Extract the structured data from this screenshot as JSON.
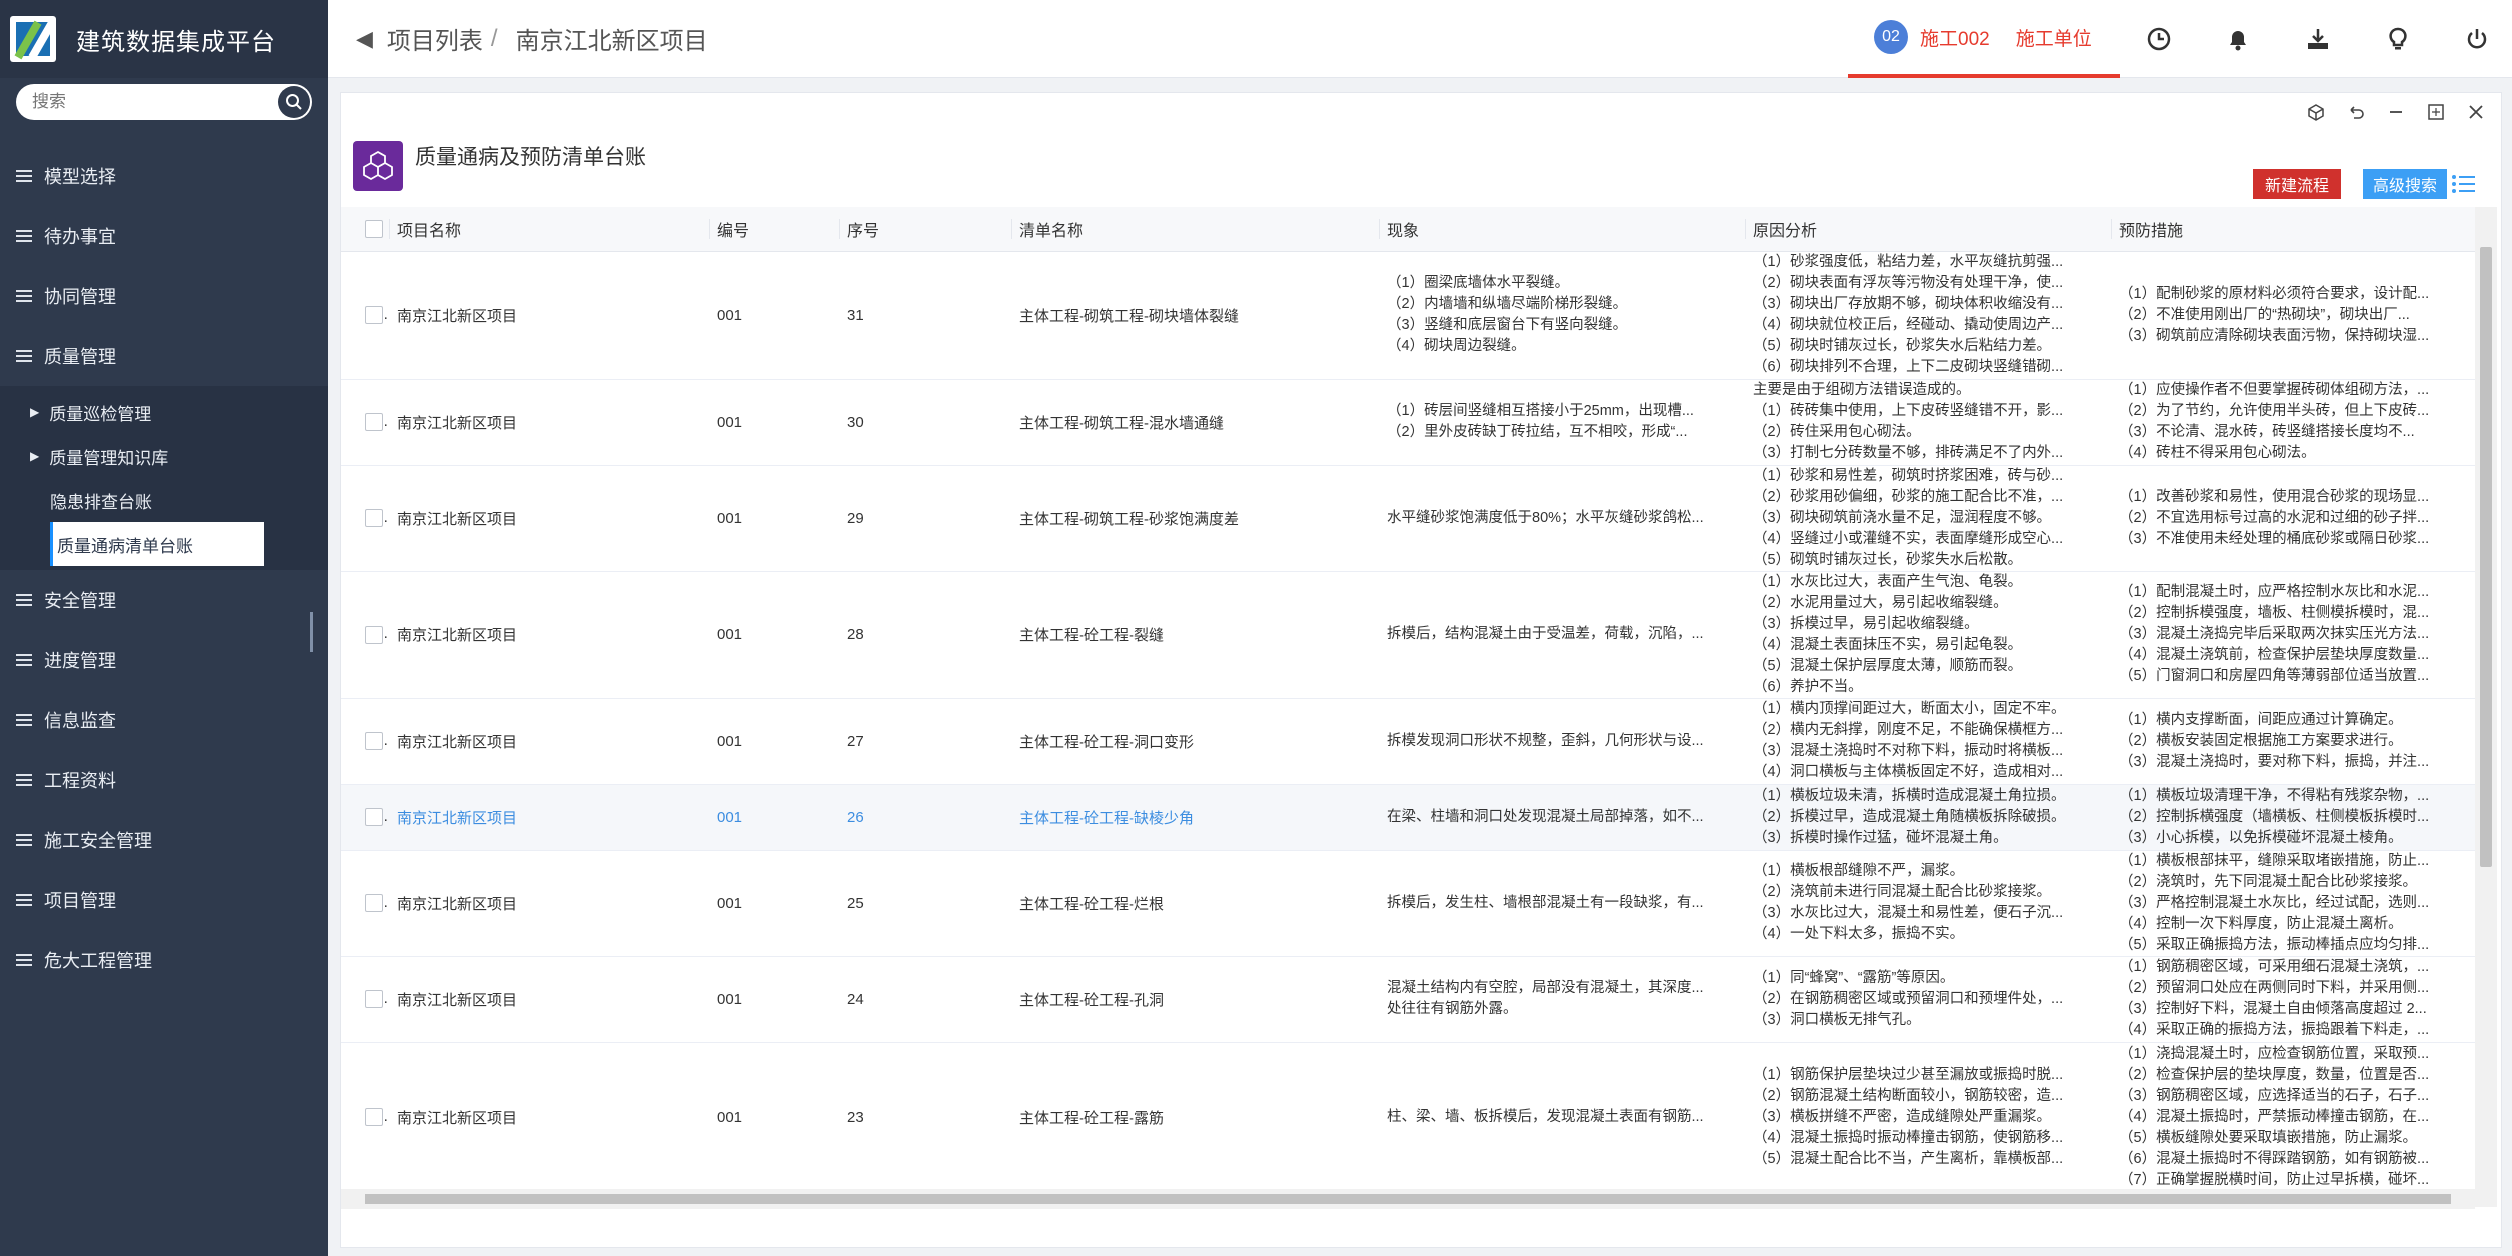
{
  "app": {
    "title": "建筑数据集成平台"
  },
  "search": {
    "placeholder": "搜索"
  },
  "sidebar": {
    "items": [
      {
        "label": "模型选择"
      },
      {
        "label": "待办事宜"
      },
      {
        "label": "协同管理"
      },
      {
        "label": "质量管理"
      },
      {
        "label": "安全管理"
      },
      {
        "label": "进度管理"
      },
      {
        "label": "信息监查"
      },
      {
        "label": "工程资料"
      },
      {
        "label": "施工安全管理"
      },
      {
        "label": "项目管理"
      },
      {
        "label": "危大工程管理"
      }
    ],
    "quality_sub": [
      {
        "label": "质量巡检管理"
      },
      {
        "label": "质量管理知识库"
      },
      {
        "label": "隐患排查台账"
      },
      {
        "label": "质量通病清单台账"
      }
    ]
  },
  "breadcrumb": {
    "parent": "项目列表",
    "separator": "/",
    "current": "南京江北新区项目"
  },
  "user": {
    "badge": "02",
    "name": "施工002",
    "role": "施工单位"
  },
  "panel": {
    "title": "质量通病及预防清单台账",
    "new_flow": "新建流程",
    "advanced_search": "高级搜索"
  },
  "table": {
    "headers": [
      "项目名称",
      "编号",
      "序号",
      "清单名称",
      "现象",
      "原因分析",
      "预防措施"
    ],
    "rows": [
      {
        "project": "南京江北新区项目",
        "code": "001",
        "seq": "31",
        "name": "主体工程-砌筑工程-砌块墙体裂缝",
        "phenomenon": [
          "（1）圈梁底墙体水平裂缝。",
          "（2）内墙墙和纵墙尽端阶梯形裂缝。",
          "（3）竖缝和底层窗台下有竖向裂缝。",
          "（4）砌块周边裂缝。"
        ],
        "cause": [
          "（1）砂浆强度低，粘结力差，水平灰缝抗剪强...",
          "（2）砌块表面有浮灰等污物没有处理干净，使...",
          "（3）砌块出厂存放期不够，砌块体积收缩没有...",
          "（4）砌块就位校正后，经碰动、撬动使周边产...",
          "（5）砌块时铺灰过长，砂浆失水后粘结力差。",
          "（6）砌块排列不合理，上下二皮砌块竖缝错砌..."
        ],
        "prevention": [
          "（1）配制砂浆的原材料必须符合要求，设计配...",
          "（2）不准使用刚出厂的“热砌块”，砌块出厂...",
          "（3）砌筑前应清除砌块表面污物，保持砌块湿..."
        ]
      },
      {
        "project": "南京江北新区项目",
        "code": "001",
        "seq": "30",
        "name": "主体工程-砌筑工程-混水墙通缝",
        "phenomenon": [
          "（1）砖层间竖缝相互搭接小于25mm，出现槽...",
          "（2）里外皮砖缺丁砖拉结，互不相咬，形成“..."
        ],
        "cause": [
          "主要是由于组砌方法错误造成的。",
          "（1）砖砖集中使用，上下皮砖竖缝错不开，影...",
          "（2）砖住采用包心砌法。",
          "（3）打制七分砖数量不够，排砖满足不了内外..."
        ],
        "prevention": [
          "（1）应使操作者不但要掌握砖砌体组砌方法，...",
          "（2）为了节约，允许使用半头砖，但上下皮砖...",
          "（3）不论清、混水砖，砖竖缝搭接长度均不...",
          "（4）砖柱不得采用包心砌法。"
        ]
      },
      {
        "project": "南京江北新区项目",
        "code": "001",
        "seq": "29",
        "name": "主体工程-砌筑工程-砂浆饱满度差",
        "phenomenon": [
          "水平缝砂浆饱满度低于80%；水平灰缝砂浆鸽松..."
        ],
        "cause": [
          "（1）砂浆和易性差，砌筑时挤浆困难，砖与砂...",
          "（2）砂浆用砂偏细，砂浆的施工配合比不准，...",
          "（3）砌块砌筑前浇水量不足，湿润程度不够。",
          "（4）竖缝过小或灌缝不实，表面摩缝形成空心...",
          "（5）砌筑时铺灰过长，砂浆失水后松散。"
        ],
        "prevention": [
          "（1）改善砂浆和易性，使用混合砂浆的现场显...",
          "（2）不宜选用标号过高的水泥和过细的砂子拌...",
          "（3）不准使用未经处理的桶底砂浆或隔日砂浆..."
        ]
      },
      {
        "project": "南京江北新区项目",
        "code": "001",
        "seq": "28",
        "name": "主体工程-砼工程-裂缝",
        "phenomenon": [
          "拆模后，结构混凝土由于受温差，荷载，沉陷，..."
        ],
        "cause": [
          "（1）水灰比过大，表面产生气泡、龟裂。",
          "（2）水泥用量过大，易引起收缩裂缝。",
          "（3）拆模过早，易引起收缩裂缝。",
          "（4）混凝土表面抹压不实，易引起龟裂。",
          "（5）混凝土保护层厚度太薄，顺筋而裂。",
          "（6）养护不当。"
        ],
        "prevention": [
          "（1）配制混凝土时，应严格控制水灰比和水泥...",
          "（2）控制拆模强度，墙板、柱侧模拆模时，混...",
          "（3）混凝土浇捣完毕后采取两次抹实压光方法...",
          "（4）混凝土浇筑前，检查保护层垫块厚度数量...",
          "（5）门窗洞口和房屋四角等薄弱部位适当放置..."
        ]
      },
      {
        "project": "南京江北新区项目",
        "code": "001",
        "seq": "27",
        "name": "主体工程-砼工程-洞口变形",
        "phenomenon": [
          "拆模发现洞口形状不规整，歪斜，几何形状与设..."
        ],
        "cause": [
          "（1）横内顶撑间距过大，断面太小，固定不牢。",
          "（2）横内无斜撑，刚度不足，不能确保横框方...",
          "（3）混凝土浇捣时不对称下料，振动时将横板...",
          "（4）洞口横板与主体横板固定不好，造成相对..."
        ],
        "prevention": [
          "（1）横内支撑断面，间距应通过计算确定。",
          "（2）横板安装固定根据施工方案要求进行。",
          "（3）混凝土浇捣时，要对称下料，振捣，并注..."
        ]
      },
      {
        "project": "南京江北新区项目",
        "code": "001",
        "seq": "26",
        "name": "主体工程-砼工程-缺棱少角",
        "phenomenon": [
          "在梁、柱墙和洞口处发现混凝土局部掉落，如不..."
        ],
        "cause": [
          "（1）横板垃圾未清，拆横时造成混凝土角拉损。",
          "（2）拆模过早，造成混凝土角随横板拆除破损。",
          "（3）拆模时操作过猛，碰坏混凝土角。"
        ],
        "prevention": [
          "（1）横板垃圾清理干净，不得粘有残浆杂物，...",
          "（2）控制拆横强度（墙横板、柱侧模板拆模时...",
          "（3）小心拆模，以免拆模碰坏混凝土棱角。"
        ]
      },
      {
        "project": "南京江北新区项目",
        "code": "001",
        "seq": "25",
        "name": "主体工程-砼工程-烂根",
        "phenomenon": [
          "拆模后，发生柱、墙根部混凝土有一段缺浆，有..."
        ],
        "cause": [
          "（1）横板根部缝隙不严，漏浆。",
          "（2）浇筑前未进行同混凝土配合比砂浆接浆。",
          "（3）水灰比过大，混凝土和易性差，便石子沉...",
          "（4）一处下料太多，振捣不实。"
        ],
        "prevention": [
          "（1）横板根部抹平，缝隙采取堵嵌措施，防止...",
          "（2）浇筑时，先下同混凝土配合比砂浆接浆。",
          "（3）严格控制混凝土水灰比，经过试配，选则...",
          "（4）控制一次下料厚度，防止混凝土离析。",
          "（5）采取正确振捣方法，振动棒插点应均匀排..."
        ]
      },
      {
        "project": "南京江北新区项目",
        "code": "001",
        "seq": "24",
        "name": "主体工程-砼工程-孔洞",
        "phenomenon": [
          "混凝土结构内有空腔，局部没有混凝土，其深度...",
          "处往往有钢筋外露。"
        ],
        "cause": [
          "（1）同“蜂窝”、“露筋”等原因。",
          "（2）在钢筋稠密区域或预留洞口和预埋件处，...",
          "（3）洞口横板无排气孔。"
        ],
        "prevention": [
          "（1）钢筋稠密区域，可采用细石混凝土浇筑，...",
          "（2）预留洞口处应在两侧同时下料，并采用侧...",
          "（3）控制好下料，混凝土自由倾落高度超过 2...",
          "（4）采取正确的振捣方法，振捣跟着下料走，..."
        ]
      },
      {
        "project": "南京江北新区项目",
        "code": "001",
        "seq": "23",
        "name": "主体工程-砼工程-露筋",
        "phenomenon": [
          "柱、梁、墙、板拆模后，发现混凝土表面有钢筋..."
        ],
        "cause": [
          "（1）钢筋保护层垫块过少甚至漏放或振捣时脱...",
          "（2）钢筋混凝土结构断面较小，钢筋较密，造...",
          "（3）横板拼缝不严密，造成缝隙处严重漏浆。",
          "（4）混凝土振捣时振动棒撞击钢筋，使钢筋移...",
          "（5）混凝土配合比不当，产生离析，靠横板部..."
        ],
        "prevention": [
          "（1）浇捣混凝土时，应检查钢筋位置，采取预...",
          "（2）检查保护层的垫块厚度，数量，位置是否...",
          "（3）钢筋稠密区域，应选择适当的石子，石子...",
          "（4）混凝土振捣时，严禁振动棒撞击钢筋，在...",
          "（5）横板缝隙处要采取填嵌措施，防止漏浆。",
          "（6）混凝土振捣时不得踩踏钢筋，如有钢筋被...",
          "（7）正确掌握脱横时间，防止过早拆横，碰坏..."
        ]
      }
    ]
  }
}
